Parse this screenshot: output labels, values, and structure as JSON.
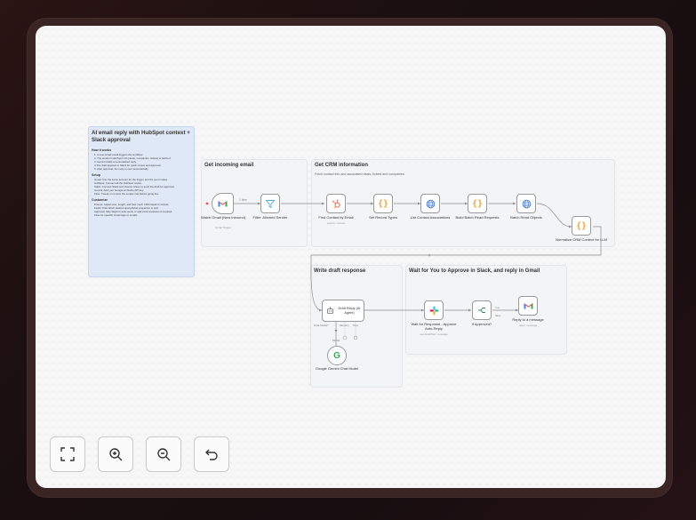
{
  "sticky_note": {
    "title": "AI email reply with HubSpot context + Slack approval",
    "how_it_works_heading": "How it works",
    "how_it_works": [
      "1. A new Gmail email triggers the workflow.",
      "2. The sender's HubSpot info (deals, companies, tickets) is fetched.",
      "3. Gemini drafts a personalized reply.",
      "4.The draft appears in Slack for quick review and approval.",
      "5. After approval, the reply is sent automatically."
    ],
    "setup_heading": "Setup",
    "setup": [
      "Gmail: Use the same account for the trigger and the send nodes.",
      "HubSpot: Connect all the HubSpot nodes.",
      "Slack: Connect Slack and choose where to send the draft for approval.",
      "Gemini: Add your Google AI Studio API key.",
      "Filter: Tweak or remove the sender rule before going live."
    ],
    "customize_heading": "Customize",
    "customize": [
      "Prompt: Adjust tone, length, and how much CRM detail to include.",
      "Fields: Pick which deal/company/ticket properties to pull.",
      "Approval: Skip Slack to auto-send, or add extra reviewers if required.",
      "Filter for specific Gmail tags or emails."
    ]
  },
  "groups": {
    "incoming": {
      "title": "Get incoming email"
    },
    "crm": {
      "title": "Get CRM information",
      "subtitle": "Fetch contact info and associated deals, tickets and companies."
    },
    "draft": {
      "title": "Write draft response"
    },
    "approve": {
      "title": "Wait for You to Approve in Slack, and reply in Gmail"
    }
  },
  "nodes": {
    "watch_gmail": {
      "label": "Watch Gmail (New Inbound)",
      "sub": "Gmail Trigger",
      "icon": "gmail-icon"
    },
    "filter": {
      "label": "Filter: Allowed Sender",
      "icon": "filter-icon"
    },
    "find_contact": {
      "label": "Find Contact by Email",
      "sub": "search: contact",
      "icon": "hubspot-icon"
    },
    "set_record": {
      "label": "Set Record Types",
      "icon": "code-braces-icon"
    },
    "list_assoc": {
      "label": "List Contact Associations",
      "icon": "globe-icon"
    },
    "build_batch": {
      "label": "Build Batch Read Requests",
      "icon": "code-braces-icon"
    },
    "batch_read": {
      "label": "Batch Read Objects",
      "icon": "globe-icon"
    },
    "normalize": {
      "label": "Normalize CRM Context for LLM",
      "icon": "code-braces-icon"
    },
    "draft_reply": {
      "label": "Draft Reply (AI Agent)",
      "icon": "robot-icon"
    },
    "gemini": {
      "label": "Google Gemini Chat Model",
      "icon": "google-icon"
    },
    "wait_response": {
      "label": "Wait for Response - Approve Auto-Reply",
      "sub": "sendAndWait: message",
      "icon": "slack-icon"
    },
    "if_approved": {
      "label": "If Approved?",
      "icon": "if-icon"
    },
    "reply": {
      "label": "Reply to a message",
      "sub": "reply: message",
      "icon": "gmail-icon"
    }
  },
  "edge_labels": {
    "items": "1 item"
  },
  "ports": {
    "chat_model": "Chat Model*",
    "memory": "Memory",
    "tool": "Tool",
    "model": "Model",
    "true": "true",
    "false": "false"
  },
  "controls": [
    "fit-view-icon",
    "zoom-in-icon",
    "zoom-out-icon",
    "undo-icon"
  ],
  "colors": {
    "gmail_red": "#EA4335",
    "hubspot_orange": "#FF7A59",
    "code_orange": "#F2A33A",
    "globe_blue": "#3B6FD9",
    "filter_blue": "#4CA9E8",
    "if_green": "#2E8B57",
    "note_blue": "#DFE8F7"
  }
}
